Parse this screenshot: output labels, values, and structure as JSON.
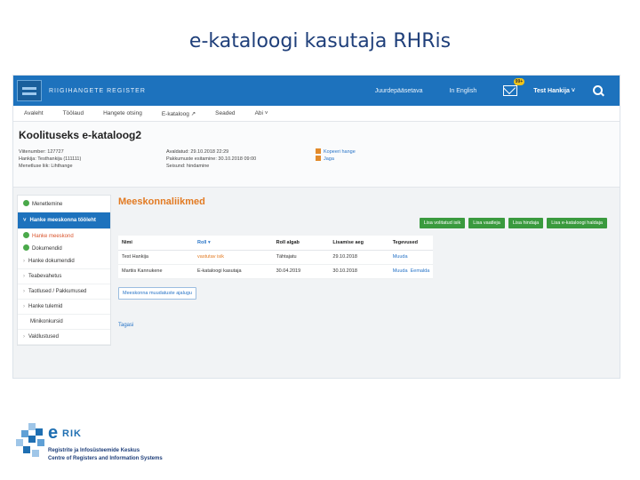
{
  "slide": {
    "title": "e-kataloogi kasutaja RHRis"
  },
  "topbar": {
    "brand": "RIIGIHANGETE REGISTER",
    "links": [
      "Juurdepääsetava",
      "In English"
    ],
    "mail_badge": "99+",
    "user": "Test Hankija ˅"
  },
  "nav": {
    "items": [
      "Avaleht",
      "Töölaud",
      "Hangete otsing",
      "E-kataloog ↗",
      "Seaded",
      "Abi ˅"
    ]
  },
  "page": {
    "title": "Koolituseks e-kataloog2",
    "meta_left": [
      "Viitenumber: 127727",
      "Hankija: Testhankija (111111)",
      "Menetluse liik: Lihthange"
    ],
    "meta_mid": [
      "Avaldatud: 29.10.2018 22:29",
      "Pakkumuste esitamine: 30.10.2018 09:00",
      "Seisund: hindamine"
    ],
    "actions": [
      "Kopeeri hange",
      "Jaga"
    ]
  },
  "sidebar": {
    "heading": "Menetlemine",
    "open_item": "Hanke meeskonna tööleht",
    "sub_items": [
      "Hanke meeskond",
      "Dokumendid"
    ],
    "items": [
      "Hanke dokumendid",
      "Teabevahetus",
      "Taotlused / Pakkumused",
      "Hanke tulemid",
      "Minikonkursid",
      "Valdlustused"
    ]
  },
  "main": {
    "section_title": "Meeskonnaliikmed",
    "buttons": [
      "Lisa volitatud isik",
      "Lisa vaatleja",
      "Lisa hindaja",
      "Lisa e-kataloogi haldaja"
    ],
    "columns": [
      "Nimi",
      "Roll ▾",
      "Roll algab",
      "Lisamise aeg",
      "Tegevused"
    ],
    "rows": [
      {
        "name": "Test Hankija",
        "role": "vastutav isik",
        "start": "Tähtajatu",
        "added": "29.10.2018",
        "actions": [
          "Muuda"
        ]
      },
      {
        "name": "Martiis Kannukene",
        "role": "E-kataloogi kasutaja",
        "start": "30.04.2019",
        "added": "30.10.2018",
        "actions": [
          "Muuda",
          "Eemalda"
        ]
      }
    ],
    "history_button": "Meeskonna muudatuste ajalugu",
    "back_link": "Tagasi"
  },
  "footer": {
    "logo_e": "e",
    "logo_rik": "RIK",
    "line1": "Registrite ja Infosüsteemide Keskus",
    "line2": "Centre of Registers and Information Systems"
  }
}
